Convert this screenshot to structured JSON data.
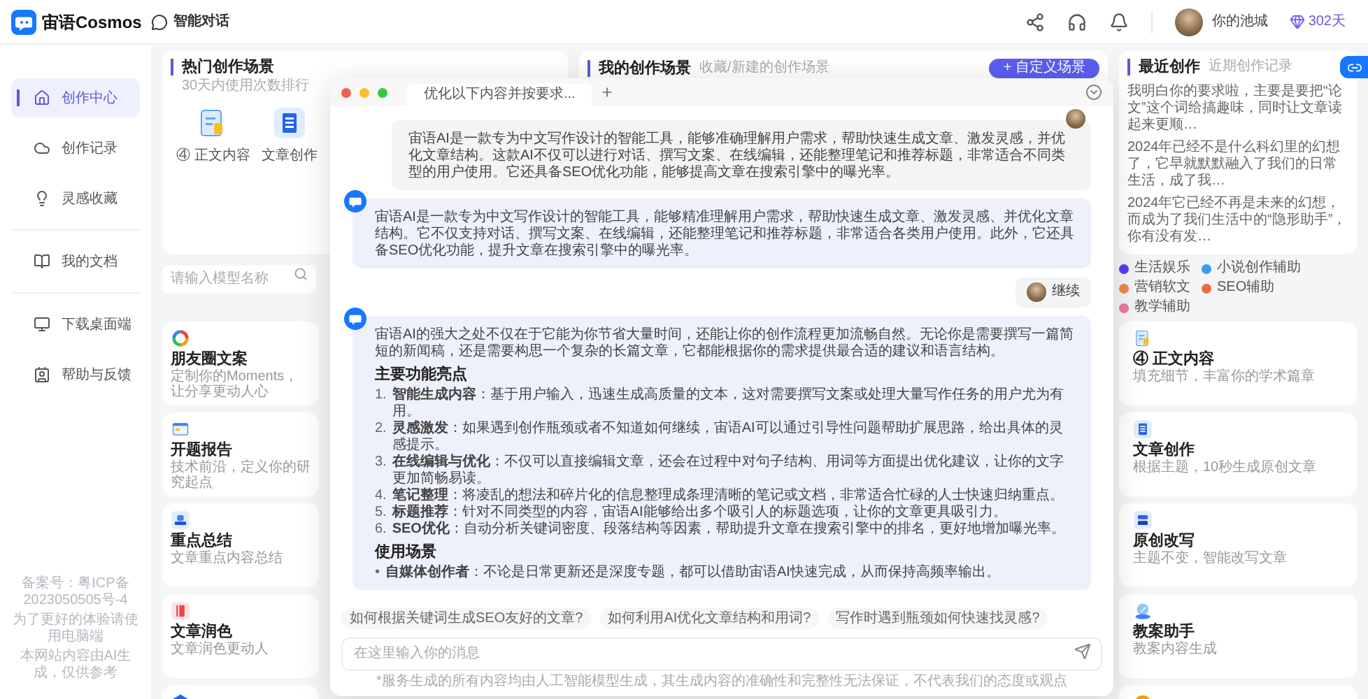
{
  "header": {
    "logo": "宙语Cosmos",
    "tab": "智能对话",
    "user": "你的池城",
    "days": "302天"
  },
  "sidebar": {
    "groups": [
      [
        {
          "label": "创作中心",
          "kind": "home",
          "selected": true
        },
        {
          "label": "创作记录",
          "kind": "cloud",
          "selected": false
        },
        {
          "label": "灵感收藏",
          "kind": "bulb",
          "selected": false
        }
      ],
      [
        {
          "label": "我的文档",
          "kind": "docs",
          "selected": false
        }
      ],
      [
        {
          "label": "下载桌面端",
          "kind": "monitor",
          "selected": false
        },
        {
          "label": "帮助与反馈",
          "kind": "contact",
          "selected": false
        }
      ]
    ],
    "footer": [
      "备案号：粤ICP备2023050505号-4",
      "为了更好的体验请使用电脑端",
      "本网站内容由AI生成，仅供参考"
    ]
  },
  "hot_scenes": {
    "title": "热门创作场景",
    "subtitle": "30天内使用次数排行",
    "items": [
      {
        "label": "④ 正文内容",
        "kind": "clipboard"
      },
      {
        "label": "文章创作",
        "kind": "doc"
      }
    ]
  },
  "my_scenes": {
    "title": "我的创作场景",
    "subtitle": "收藏/新建的创作场景",
    "button": "+ 自定义场景"
  },
  "recent": {
    "title": "最近创作",
    "subtitle": "近期创作记录",
    "items": [
      "我明白你的要求啦，主要是要把“论文”这个词给搞趣味，同时让文章读起来更顺…",
      "2024年已经不是什么科幻里的幻想了，它早就默默融入了我们的日常生活，成了我…",
      "2024年它已经不再是未来的幻想，而成为了我们生活中的“隐形助手”，你有没有发…"
    ]
  },
  "search": {
    "placeholder": "请输入模型名称"
  },
  "categories": [
    {
      "label": "生活娱乐",
      "color": "#5b3df5"
    },
    {
      "label": "小说创作辅助",
      "color": "#3b9cf0"
    },
    {
      "label": "营销软文",
      "color": "#f0874a"
    },
    {
      "label": "SEO辅助",
      "color": "#f26b3a"
    },
    {
      "label": "教学辅助",
      "color": "#e87aa0"
    }
  ],
  "cards_left": [
    {
      "kind": "ring",
      "title": "朋友圈文案",
      "desc": "定制你的Moments，让分享更动人心"
    },
    {
      "kind": "report",
      "title": "开题报告",
      "desc": "技术前沿，定义你的研究起点"
    },
    {
      "kind": "summary",
      "title": "重点总结",
      "desc": "文章重点内容总结"
    },
    {
      "kind": "book",
      "title": "文章润色",
      "desc": "文章润色更动人"
    },
    {
      "kind": "layers"
    }
  ],
  "cards_right": [
    {
      "kind": "clipboard",
      "title": "④ 正文内容",
      "desc": "填充细节，丰富你的学术篇章"
    },
    {
      "kind": "doc",
      "title": "文章创作",
      "desc": "根据主题，10秒生成原创文章"
    },
    {
      "kind": "rewrite",
      "title": "原创改写",
      "desc": "主题不变，智能改写文章"
    },
    {
      "kind": "pen",
      "title": "教案助手",
      "desc": "教案内容生成"
    },
    {
      "kind": "chat"
    }
  ],
  "chat": {
    "tab": "优化以下内容并按要求...",
    "messages": [
      {
        "kind": "user",
        "text": "宙语AI是一款专为中文写作设计的智能工具，能够准确理解用户需求，帮助快速生成文章、激发灵感，并优化文章结构。这款AI不仅可以进行对话、撰写文案、在线编辑，还能整理笔记和推荐标题，非常适合不同类型的用户使用。它还具备SEO优化功能，能够提高文章在搜索引擎中的曝光率。"
      },
      {
        "kind": "assistant",
        "text": "宙语AI是一款专为中文写作设计的智能工具，能够精准理解用户需求，帮助快速生成文章、激发灵感、并优化文章结构。它不仅支持对话、撰写文案、在线编辑，还能整理笔记和推荐标题，非常适合各类用户使用。此外，它还具备SEO优化功能，提升文章在搜索引擎中的曝光率。"
      },
      {
        "kind": "user",
        "text": "继续"
      },
      {
        "kind": "assistant",
        "blocks": [
          {
            "kind": "paragraph",
            "text": "宙语AI的强大之处不仅在于它能为你节省大量时间，还能让你的创作流程更加流畅自然。无论你是需要撰写一篇简短的新闻稿，还是需要构思一个复杂的长篇文章，它都能根据你的需求提供最合适的建议和语言结构。"
          },
          {
            "kind": "heading",
            "text": "主要功能亮点"
          },
          {
            "kind": "list",
            "items": [
              {
                "marker": "1.",
                "text": "**智能生成内容**：基于用户输入，迅速生成高质量的文本，这对需要撰写文案或处理大量写作任务的用户尤为有用。"
              },
              {
                "marker": "2.",
                "text": "**灵感激发**：如果遇到创作瓶颈或者不知道如何继续，宙语AI可以通过引导性问题帮助扩展思路，给出具体的灵感提示。"
              },
              {
                "marker": "3.",
                "text": "**在线编辑与优化**：不仅可以直接编辑文章，还会在过程中对句子结构、用词等方面提出优化建议，让你的文字更加简畅易读。"
              },
              {
                "marker": "4.",
                "text": "**笔记整理**：将凌乱的想法和碎片化的信息整理成条理清晰的笔记或文档，非常适合忙碌的人士快速归纳重点。"
              },
              {
                "marker": "5.",
                "text": "**标题推荐**：针对不同类型的内容，宙语AI能够给出多个吸引人的标题选项，让你的文章更具吸引力。"
              },
              {
                "marker": "6.",
                "text": "**SEO优化**：自动分析关键词密度、段落结构等因素，帮助提升文章在搜索引擎中的排名，更好地增加曝光率。"
              }
            ]
          },
          {
            "kind": "heading",
            "text": "使用场景"
          },
          {
            "kind": "list",
            "items": [
              {
                "marker": "•",
                "text": "**自媒体创作者**：不论是日常更新还是深度专题，都可以借助宙语AI快速完成，从而保持高频率输出。"
              }
            ]
          }
        ]
      }
    ],
    "suggestions": [
      "如何根据关键词生成SEO友好的文章?",
      "如何利用AI优化文章结构和用词?",
      "写作时遇到瓶颈如何快速找灵感?"
    ],
    "input": {
      "placeholder": "在这里输入你的消息"
    },
    "disclaimer": "*服务生成的所有内容均由人工智能模型生成，其生成内容的准确性和完整性无法保证，不代表我们的态度或观点"
  }
}
